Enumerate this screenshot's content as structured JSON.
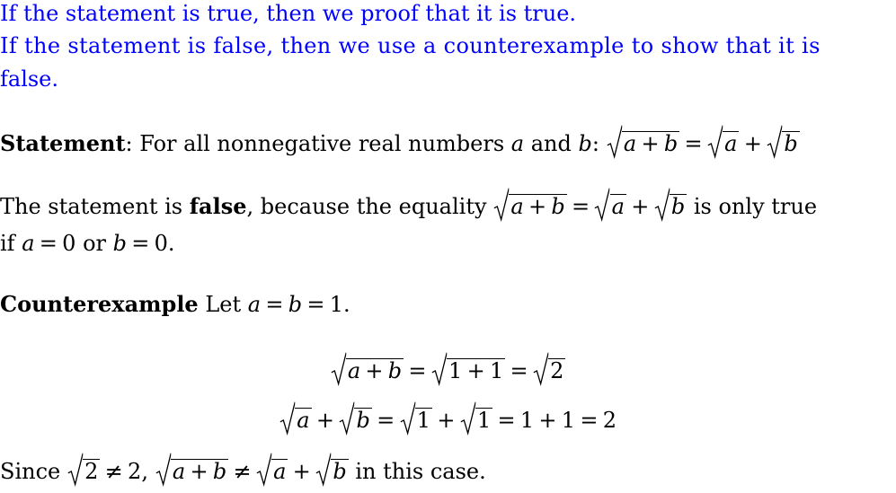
{
  "intro": {
    "line1": "If the statement is true, then we proof that it is true.",
    "line2": "If the statement is false, then we use a counterexample to show that it is",
    "line3": "false.",
    "color": "#0000ff"
  },
  "statement": {
    "label": "Statement",
    "text": ": For all nonnegative real numbers",
    "var_a": "a",
    "and": "and",
    "var_b": "b",
    "colon": ":",
    "equation": {
      "lhs_radicand": [
        "a",
        "+",
        "b"
      ],
      "rhs": [
        [
          "a"
        ],
        "+",
        [
          "b"
        ]
      ]
    }
  },
  "answer": {
    "prefix": "The statement is ",
    "bold": "false",
    "middle": ", because the equality ",
    "suffix": " is only true",
    "line2_if": "if",
    "cond1": [
      "a",
      "=",
      "0"
    ],
    "or": "or",
    "cond2": [
      "b",
      "=",
      "0."
    ]
  },
  "counterexample": {
    "label": "Counterexample",
    "let": "Let",
    "assign": [
      "a",
      "=",
      "b",
      "=",
      "1."
    ],
    "display1": {
      "t1": [
        "a",
        "+",
        "b"
      ],
      "eq": "=",
      "t2": [
        "1",
        "+",
        "1"
      ],
      "t3": "2"
    },
    "display2": {
      "a": "a",
      "plus": "+",
      "b": "b",
      "eq": "=",
      "one": "1",
      "result": [
        "1",
        "+",
        "1",
        "=",
        "2"
      ]
    }
  },
  "conclusion": {
    "since": "Since",
    "two": "2",
    "neq": "≠",
    "two_comma": "2,",
    "tail": "in this case."
  }
}
